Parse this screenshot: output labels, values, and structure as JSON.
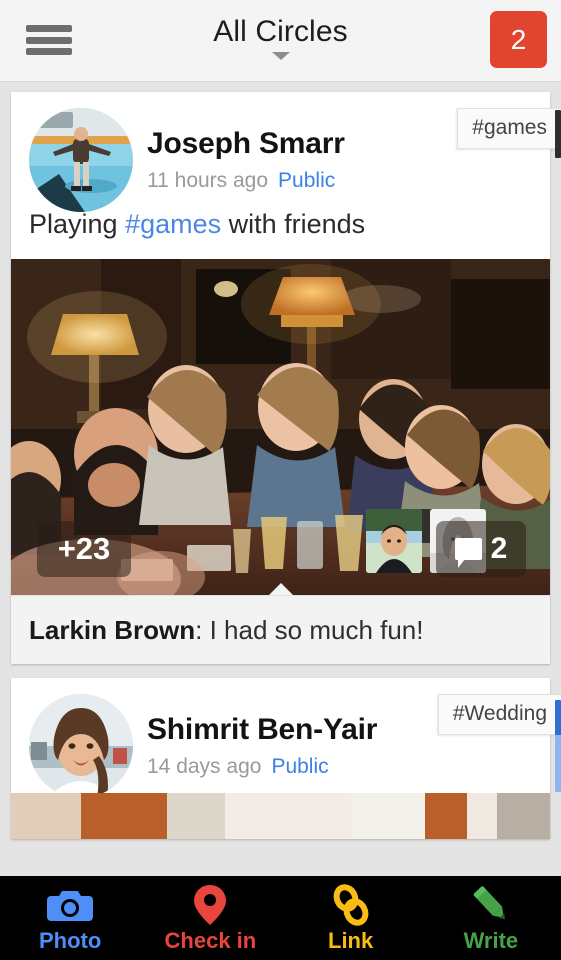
{
  "topbar": {
    "menu_icon": "hamburger-icon",
    "title": "All Circles",
    "caret_icon": "chevron-down-icon",
    "notification_count": "2",
    "notification_color": "#e2452f"
  },
  "posts": [
    {
      "author": "Joseph Smarr",
      "avatar_name": "avatar-joseph-smarr",
      "time": "11 hours ago",
      "visibility": "Public",
      "tag": "#games",
      "text_before": "Playing ",
      "hashtag": "#games",
      "text_after": " with friends",
      "photo_name": "photo-friends-at-table",
      "more_count": "+23",
      "comment_icon": "comment-bubble-icon",
      "comment_count": "2",
      "tagged_faces": [
        "tagged-face-1",
        "tagged-face-2"
      ],
      "comment_author": "Larkin Brown",
      "comment_text": ": I had so much fun!"
    },
    {
      "author": "Shimrit Ben-Yair",
      "avatar_name": "avatar-shimrit-ben-yair",
      "time": "14 days ago",
      "visibility": "Public",
      "tag": "#Wedding",
      "photo_name": "photo-wedding-partial"
    }
  ],
  "bottomnav": [
    {
      "label": "Photo",
      "icon": "camera-icon",
      "color": "#4e8ef7"
    },
    {
      "label": "Check in",
      "icon": "location-pin-icon",
      "color": "#e8453c"
    },
    {
      "label": "Link",
      "icon": "chain-link-icon",
      "color": "#f9bc15"
    },
    {
      "label": "Write",
      "icon": "pencil-icon",
      "color": "#46a347"
    }
  ]
}
